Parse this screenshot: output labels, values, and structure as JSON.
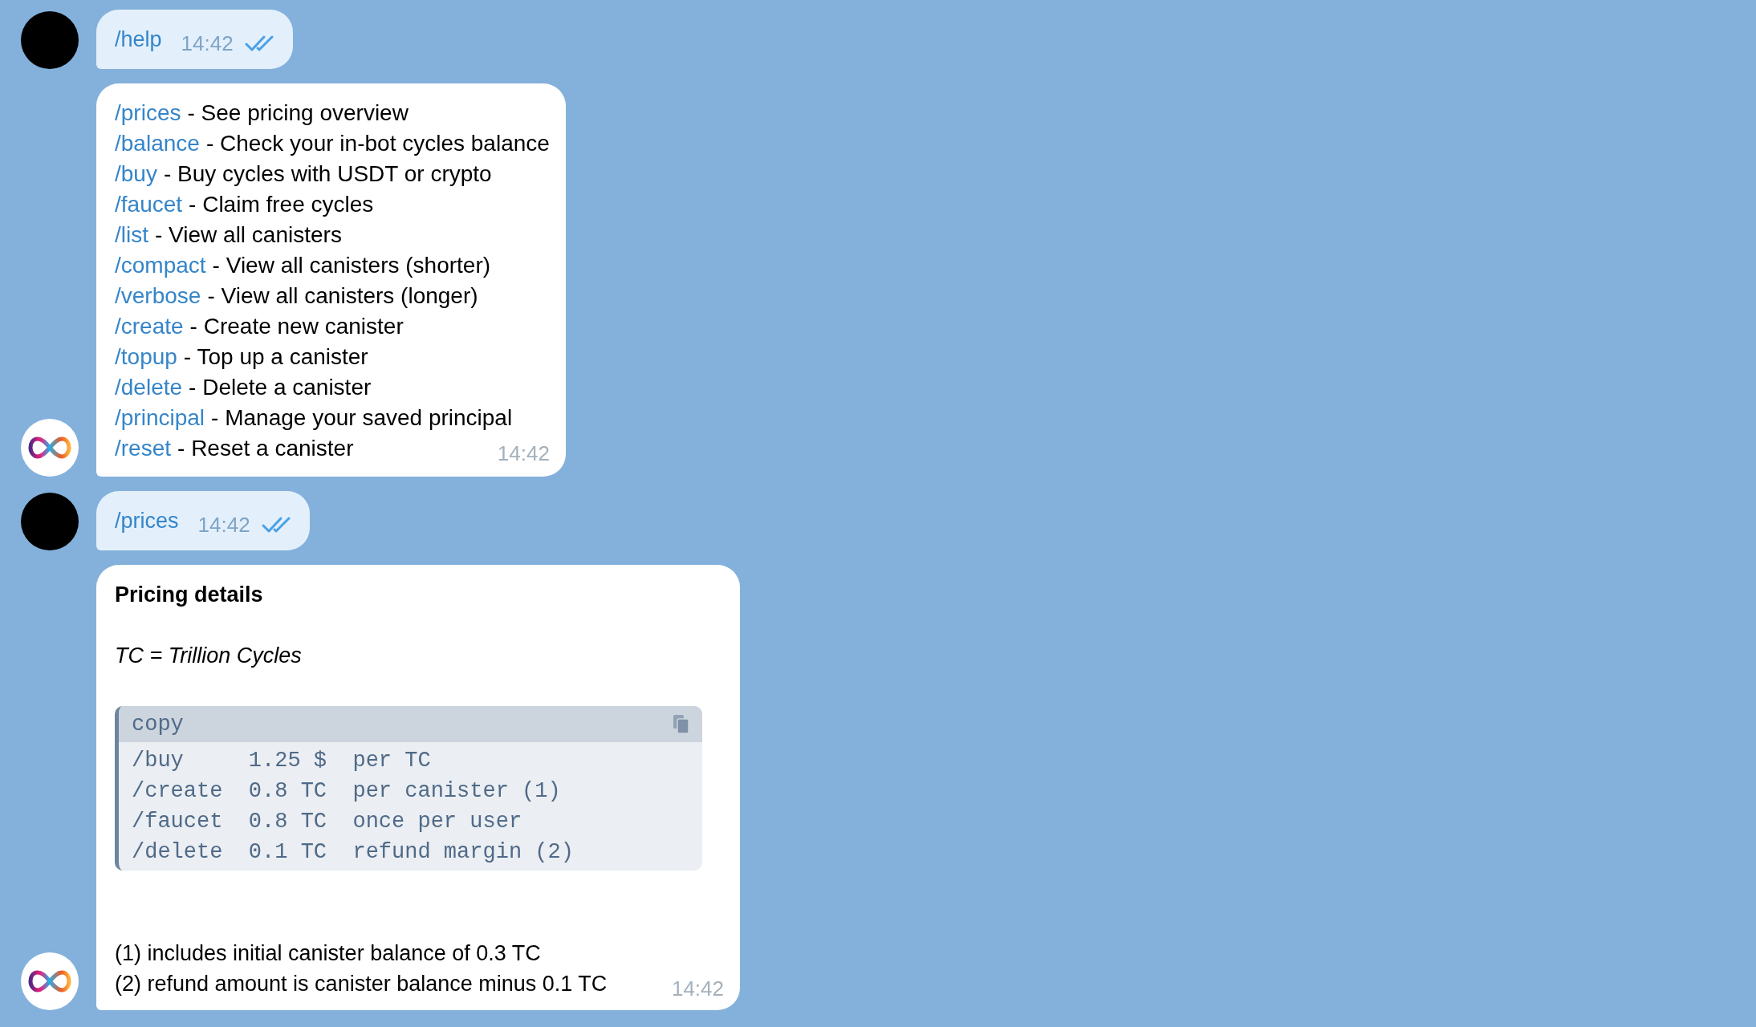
{
  "messages": [
    {
      "kind": "outgoing",
      "text": "/help",
      "time": "14:42",
      "read": true
    },
    {
      "kind": "help",
      "lines": [
        {
          "command": "/prices",
          "description": "- See pricing overview"
        },
        {
          "command": "/balance",
          "description": "- Check your in-bot cycles balance"
        },
        {
          "command": "/buy",
          "description": "- Buy cycles with USDT or crypto"
        },
        {
          "command": "/faucet",
          "description": "- Claim free cycles"
        },
        {
          "command": "/list",
          "description": "- View all canisters"
        },
        {
          "command": "/compact",
          "description": "- View all canisters (shorter)"
        },
        {
          "command": "/verbose",
          "description": "- View all canisters (longer)"
        },
        {
          "command": "/create",
          "description": "- Create new canister"
        },
        {
          "command": "/topup",
          "description": "- Top up a canister"
        },
        {
          "command": "/delete",
          "description": "- Delete a canister"
        },
        {
          "command": "/principal",
          "description": "- Manage your saved principal"
        },
        {
          "command": "/reset",
          "description": "- Reset a canister"
        }
      ],
      "time": "14:42"
    },
    {
      "kind": "outgoing",
      "text": "/prices",
      "time": "14:42",
      "read": true
    },
    {
      "kind": "pricing",
      "title": "Pricing details",
      "subtitle": "TC = Trillion Cycles",
      "code": {
        "header": "copy",
        "rows": [
          "/buy     1.25 $  per TC",
          "/create  0.8 TC  per canister (1)",
          "/faucet  0.8 TC  once per user",
          "/delete  0.1 TC  refund margin (2)"
        ]
      },
      "footnotes": [
        "(1) includes initial canister balance of 0.3 TC",
        "(2) refund amount is canister balance minus 0.1 TC"
      ],
      "time": "14:42"
    }
  ]
}
